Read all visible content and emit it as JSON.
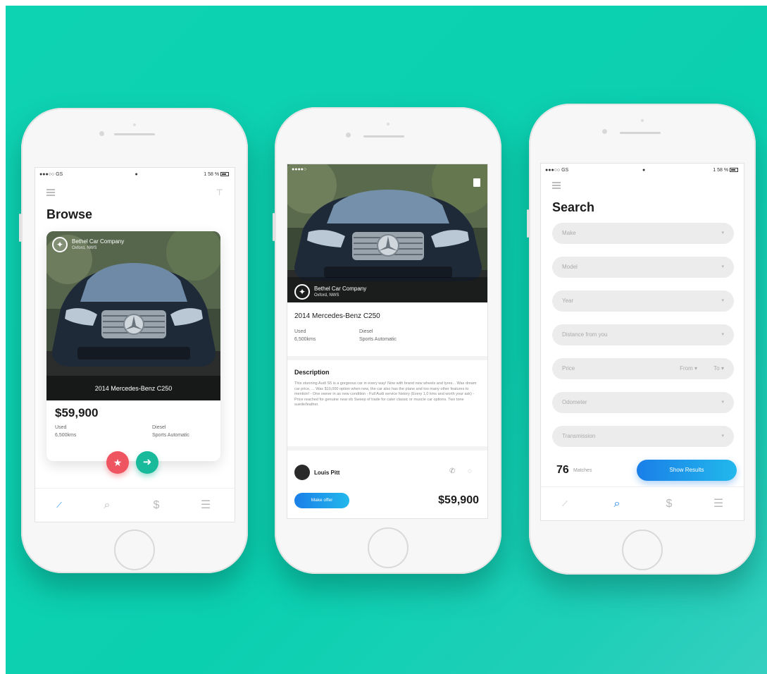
{
  "browse_screen": {
    "status": {
      "left": "●●●○○ GS",
      "right": "1 58 %"
    },
    "title": "Browse",
    "card": {
      "dealer_name": "Bethel Car Company",
      "dealer_location": "Oxford, NWS",
      "car_name": "2014 Mercedes-Benz C250",
      "price": "$59,900",
      "condition": "Used",
      "odometer": "6,500kms",
      "fuel": "Diesel",
      "transmission": "Sports Automatic"
    },
    "actions": {
      "favorite_icon": "star-icon",
      "next_icon": "arrow-right-icon"
    },
    "tabs": [
      "trend-icon",
      "search-icon",
      "dollar-icon",
      "list-icon"
    ]
  },
  "detail_screen": {
    "dealer_name": "Bethel Car Company",
    "dealer_location": "Oxford, NWS",
    "car_name": "2014 Mercedes-Benz C250",
    "condition": "Used",
    "odometer": "6,500kms",
    "fuel": "Diesel",
    "transmission": "Sports Automatic",
    "description_title": "Description",
    "description_text": "This stunning Audi S5 is a gorgeous car in every way! Now with brand new wheels and tyres... Was dream car price, ... Was $10,000 option when new, the car also has the plane and too many other features to mention! - One owner in as new condition - Full Audi service history (Every 1,0 kms and worth your ask) - Price reached for genuine near eb Sweep of trade for cater classic or muscle car options. Two tone suede/leather.",
    "seller_name": "Louis Pitt",
    "make_offer_label": "Make offer",
    "price": "$59,900"
  },
  "search_screen": {
    "status": {
      "left": "●●●○○ GS",
      "right": "1 58 %"
    },
    "title": "Search",
    "fields": [
      {
        "label": "Make"
      },
      {
        "label": "Model"
      },
      {
        "label": "Year"
      },
      {
        "label": "Distance from you"
      },
      {
        "label": "Price",
        "from": "From",
        "to": "To"
      },
      {
        "label": "Odometer"
      },
      {
        "label": "Transmission"
      }
    ],
    "matches_count": "76",
    "matches_label": "Matches",
    "show_results_label": "Show Results",
    "tabs": [
      "trend-icon",
      "search-icon",
      "dollar-icon",
      "list-icon"
    ]
  },
  "colors": {
    "background": "#0ed3b2",
    "favorite": "#ef5560",
    "next": "#19b99b",
    "accent_blue": "#1a7fe8"
  }
}
